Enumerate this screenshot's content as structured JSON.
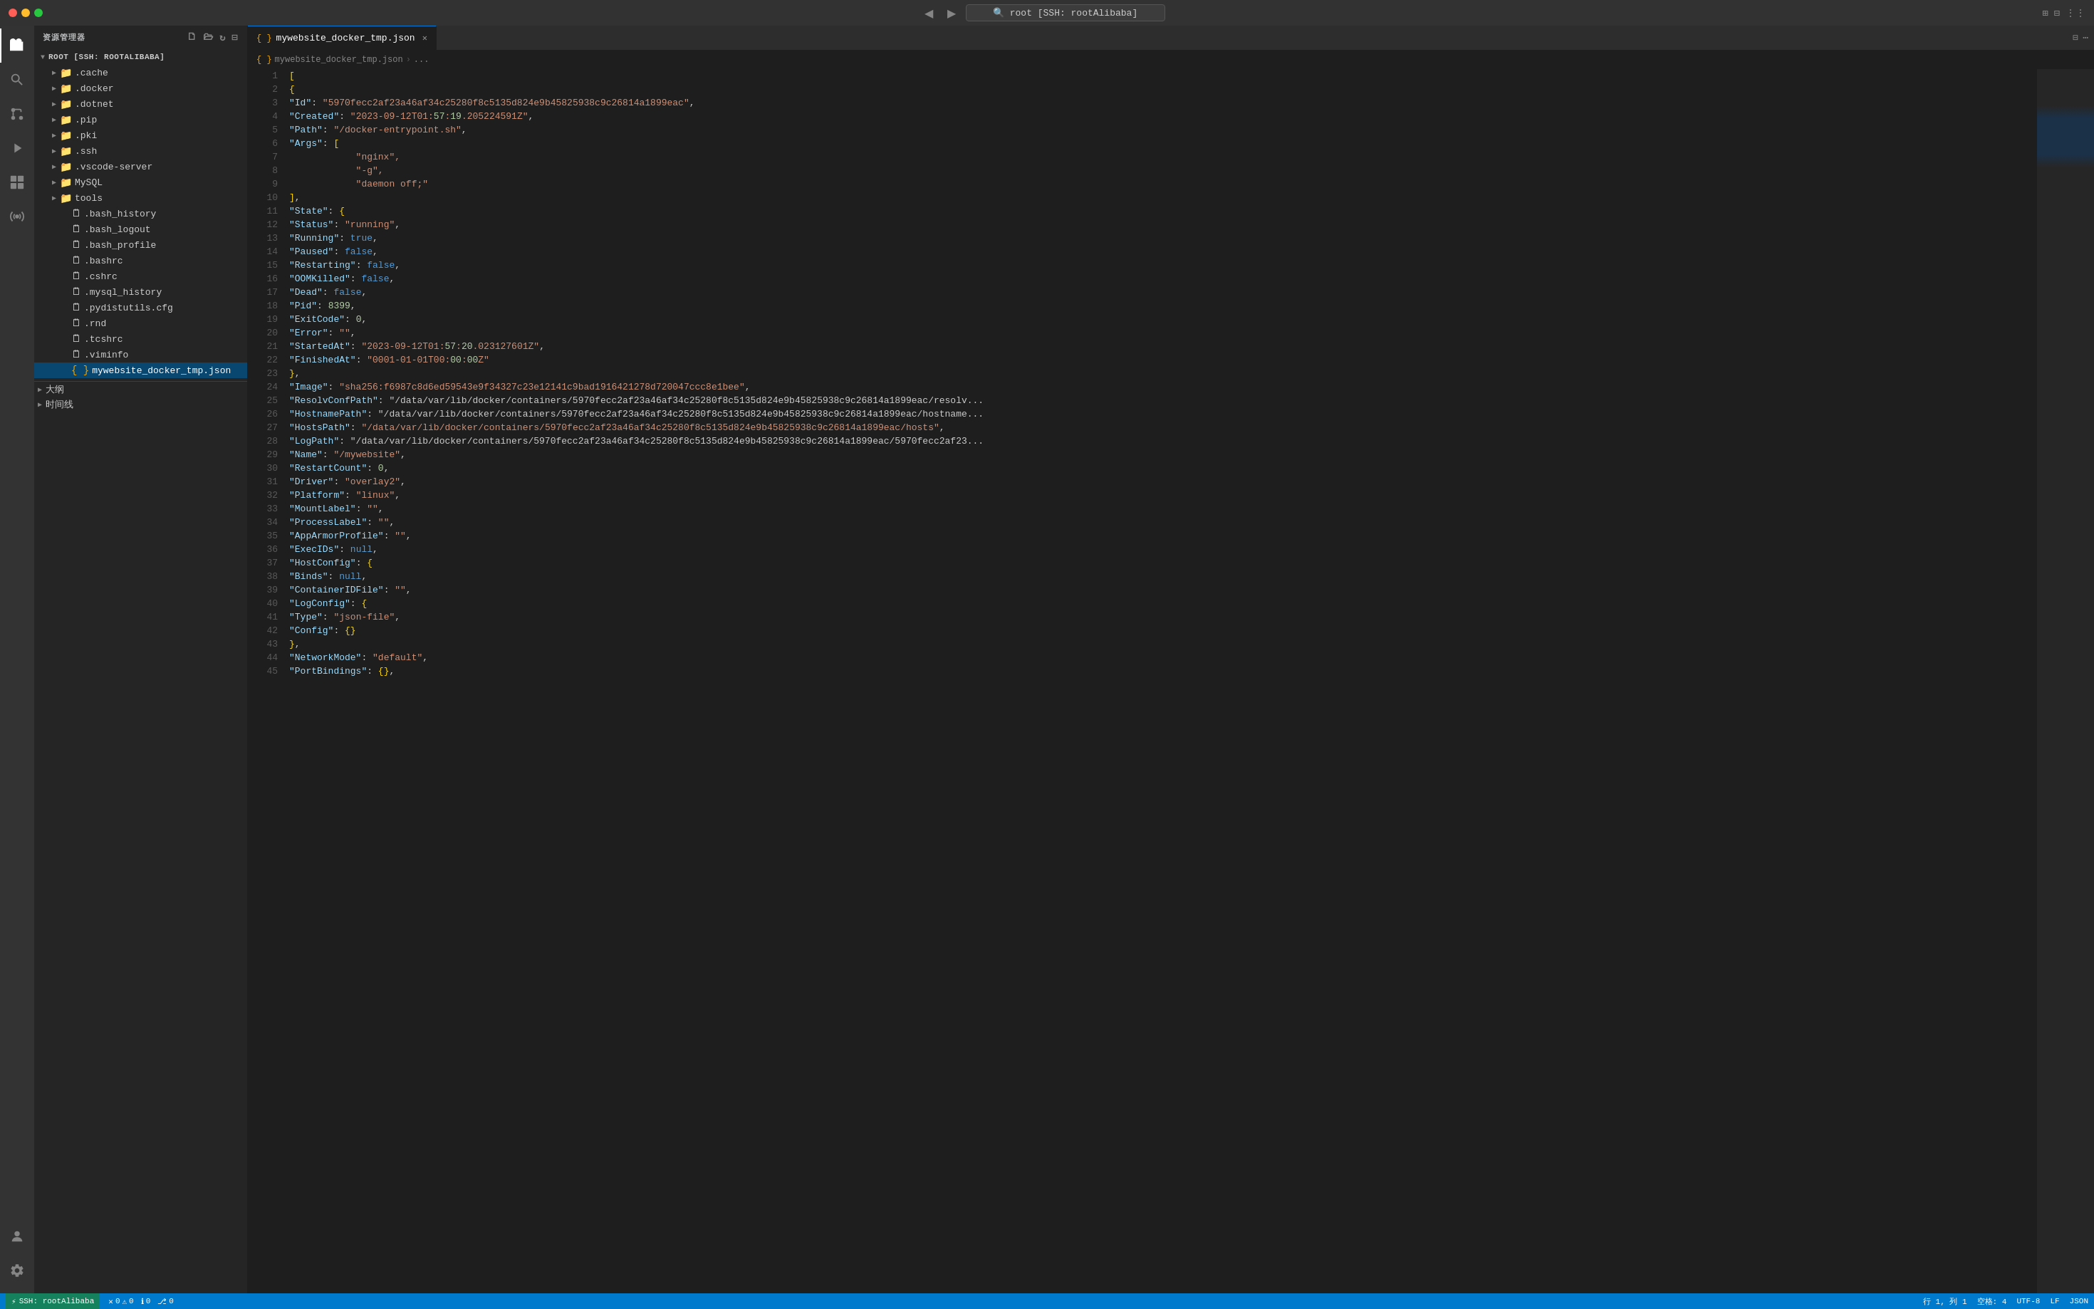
{
  "titleBar": {
    "searchText": "root [SSH: rootAlibaba]",
    "navBack": "◀",
    "navForward": "▶"
  },
  "sidebar": {
    "title": "资源管理器",
    "rootLabel": "ROOT [SSH: ROOTALIBABA]",
    "items": [
      {
        "id": "cache",
        "label": ".cache",
        "type": "folder",
        "indent": 1,
        "expanded": false
      },
      {
        "id": "docker",
        "label": ".docker",
        "type": "folder",
        "indent": 1,
        "expanded": false
      },
      {
        "id": "dotnet",
        "label": ".dotnet",
        "type": "folder",
        "indent": 1,
        "expanded": false
      },
      {
        "id": "pip",
        "label": ".pip",
        "type": "folder",
        "indent": 1,
        "expanded": false
      },
      {
        "id": "pki",
        "label": ".pki",
        "type": "folder",
        "indent": 1,
        "expanded": false
      },
      {
        "id": "ssh",
        "label": ".ssh",
        "type": "folder",
        "indent": 1,
        "expanded": false
      },
      {
        "id": "vscode-server",
        "label": ".vscode-server",
        "type": "folder",
        "indent": 1,
        "expanded": false
      },
      {
        "id": "MySQL",
        "label": "MySQL",
        "type": "folder",
        "indent": 1,
        "expanded": false
      },
      {
        "id": "tools",
        "label": "tools",
        "type": "folder",
        "indent": 1,
        "expanded": false
      },
      {
        "id": "bash_history",
        "label": ".bash_history",
        "type": "file",
        "indent": 1
      },
      {
        "id": "bash_logout",
        "label": ".bash_logout",
        "type": "file",
        "indent": 1
      },
      {
        "id": "bash_profile",
        "label": ".bash_profile",
        "type": "file",
        "indent": 1
      },
      {
        "id": "bashrc",
        "label": ".bashrc",
        "type": "file",
        "indent": 1
      },
      {
        "id": "cshrc",
        "label": ".cshrc",
        "type": "file",
        "indent": 1
      },
      {
        "id": "mysql_history",
        "label": ".mysql_history",
        "type": "file",
        "indent": 1
      },
      {
        "id": "pydistutils",
        "label": ".pydistutils.cfg",
        "type": "file",
        "indent": 1
      },
      {
        "id": "rnd",
        "label": ".rnd",
        "type": "file",
        "indent": 1
      },
      {
        "id": "tcshrc",
        "label": ".tcshrc",
        "type": "file",
        "indent": 1
      },
      {
        "id": "viminfo",
        "label": ".viminfo",
        "type": "file",
        "indent": 1
      },
      {
        "id": "mywebsite_docker_tmp",
        "label": "mywebsite_docker_tmp.json",
        "type": "json",
        "indent": 1,
        "active": true
      }
    ],
    "bottomItems": [
      {
        "id": "outline",
        "label": "大纲"
      },
      {
        "id": "timeline",
        "label": "时间线"
      }
    ]
  },
  "editor": {
    "tabs": [
      {
        "id": "mywebsite_docker_tmp",
        "label": "mywebsite_docker_tmp.json",
        "active": true,
        "type": "json"
      }
    ],
    "breadcrumb": [
      "mywebsite_docker_tmp.json",
      "..."
    ],
    "lines": [
      {
        "num": 1,
        "content": "["
      },
      {
        "num": 2,
        "content": "    {"
      },
      {
        "num": 3,
        "content": "        \"Id\": \"5970fecc2af23a46af34c25280f8c5135d824e9b45825938c9c26814a1899eac\","
      },
      {
        "num": 4,
        "content": "        \"Created\": \"2023-09-12T01:57:19.205224591Z\","
      },
      {
        "num": 5,
        "content": "        \"Path\": \"/docker-entrypoint.sh\","
      },
      {
        "num": 6,
        "content": "        \"Args\": ["
      },
      {
        "num": 7,
        "content": "            \"nginx\","
      },
      {
        "num": 8,
        "content": "            \"-g\","
      },
      {
        "num": 9,
        "content": "            \"daemon off;\""
      },
      {
        "num": 10,
        "content": "        ],"
      },
      {
        "num": 11,
        "content": "        \"State\": {"
      },
      {
        "num": 12,
        "content": "            \"Status\": \"running\","
      },
      {
        "num": 13,
        "content": "            \"Running\": true,"
      },
      {
        "num": 14,
        "content": "            \"Paused\": false,"
      },
      {
        "num": 15,
        "content": "            \"Restarting\": false,"
      },
      {
        "num": 16,
        "content": "            \"OOMKilled\": false,"
      },
      {
        "num": 17,
        "content": "            \"Dead\": false,"
      },
      {
        "num": 18,
        "content": "            \"Pid\": 8399,"
      },
      {
        "num": 19,
        "content": "            \"ExitCode\": 0,"
      },
      {
        "num": 20,
        "content": "            \"Error\": \"\","
      },
      {
        "num": 21,
        "content": "            \"StartedAt\": \"2023-09-12T01:57:20.023127601Z\","
      },
      {
        "num": 22,
        "content": "            \"FinishedAt\": \"0001-01-01T00:00:00Z\""
      },
      {
        "num": 23,
        "content": "        },"
      },
      {
        "num": 24,
        "content": "        \"Image\": \"sha256:f6987c8d6ed59543e9f34327c23e12141c9bad1916421278d720047ccc8e1bee\","
      },
      {
        "num": 25,
        "content": "        \"ResolvConfPath\": \"/data/var/lib/docker/containers/5970fecc2af23a46af34c25280f8c5135d824e9b45825938c9c26814a1899eac/resolv..."
      },
      {
        "num": 26,
        "content": "        \"HostnamePath\": \"/data/var/lib/docker/containers/5970fecc2af23a46af34c25280f8c5135d824e9b45825938c9c26814a1899eac/hostname..."
      },
      {
        "num": 27,
        "content": "        \"HostsPath\": \"/data/var/lib/docker/containers/5970fecc2af23a46af34c25280f8c5135d824e9b45825938c9c26814a1899eac/hosts\","
      },
      {
        "num": 28,
        "content": "        \"LogPath\": \"/data/var/lib/docker/containers/5970fecc2af23a46af34c25280f8c5135d824e9b45825938c9c26814a1899eac/5970fecc2af23..."
      },
      {
        "num": 29,
        "content": "        \"Name\": \"/mywebsite\","
      },
      {
        "num": 30,
        "content": "        \"RestartCount\": 0,"
      },
      {
        "num": 31,
        "content": "        \"Driver\": \"overlay2\","
      },
      {
        "num": 32,
        "content": "        \"Platform\": \"linux\","
      },
      {
        "num": 33,
        "content": "        \"MountLabel\": \"\","
      },
      {
        "num": 34,
        "content": "        \"ProcessLabel\": \"\","
      },
      {
        "num": 35,
        "content": "        \"AppArmorProfile\": \"\","
      },
      {
        "num": 36,
        "content": "        \"ExecIDs\": null,"
      },
      {
        "num": 37,
        "content": "        \"HostConfig\": {"
      },
      {
        "num": 38,
        "content": "            \"Binds\": null,"
      },
      {
        "num": 39,
        "content": "            \"ContainerIDFile\": \"\","
      },
      {
        "num": 40,
        "content": "            \"LogConfig\": {"
      },
      {
        "num": 41,
        "content": "                \"Type\": \"json-file\","
      },
      {
        "num": 42,
        "content": "                \"Config\": {}"
      },
      {
        "num": 43,
        "content": "            },"
      },
      {
        "num": 44,
        "content": "            \"NetworkMode\": \"default\","
      },
      {
        "num": 45,
        "content": "            \"PortBindings\": {},"
      }
    ]
  },
  "statusBar": {
    "ssh": "SSH: rootAlibaba",
    "errors": "0",
    "warnings": "0",
    "info": "0",
    "git": "0",
    "line": "行 1, 列 1",
    "spaces": "空格: 4",
    "encoding": "UTF-8",
    "lineEnding": "LF",
    "language": "JSON"
  },
  "activityBar": {
    "icons": [
      "explorer",
      "search",
      "source-control",
      "run",
      "extensions",
      "remote-explorer"
    ],
    "bottomIcons": [
      "accounts",
      "settings"
    ]
  }
}
